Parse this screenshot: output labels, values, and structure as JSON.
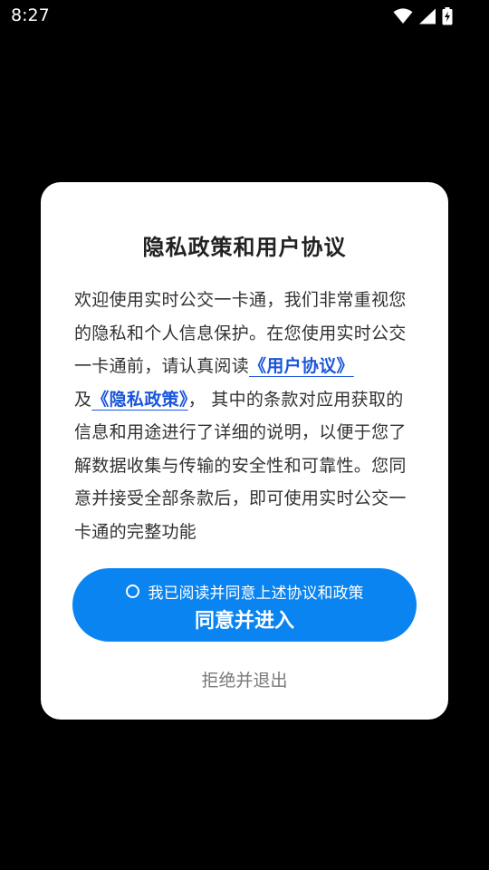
{
  "status_bar": {
    "time": "8:27",
    "icons": [
      "wifi-icon",
      "cellular-signal-icon",
      "battery-charging-icon"
    ]
  },
  "dialog": {
    "title": "隐私政策和用户协议",
    "body_part1": "欢迎使用实时公交一卡通，我们非常重视您的隐私和个人信息保护。在您使用实时公交一卡通前，请认真阅读",
    "user_agreement_link": "《用户协议》",
    "body_and": "及",
    "privacy_policy_link": "《隐私政策》",
    "body_part2": "， 其中的条款对应用获取的信息和用途进行了详细的说明，以便于您了解数据收集与传输的安全性和可靠性。您同意并接受全部条款后，即可使用实时公交一卡通的完整功能",
    "checkbox_label": "我已阅读并同意上述协议和政策",
    "agree_button_label": "同意并进入",
    "decline_button_label": "拒绝并退出"
  },
  "colors": {
    "background": "#000000",
    "dialog_background": "#ffffff",
    "primary_button": "#0a84f0",
    "link": "#1a56db",
    "decline_text": "#7a7a7a"
  }
}
